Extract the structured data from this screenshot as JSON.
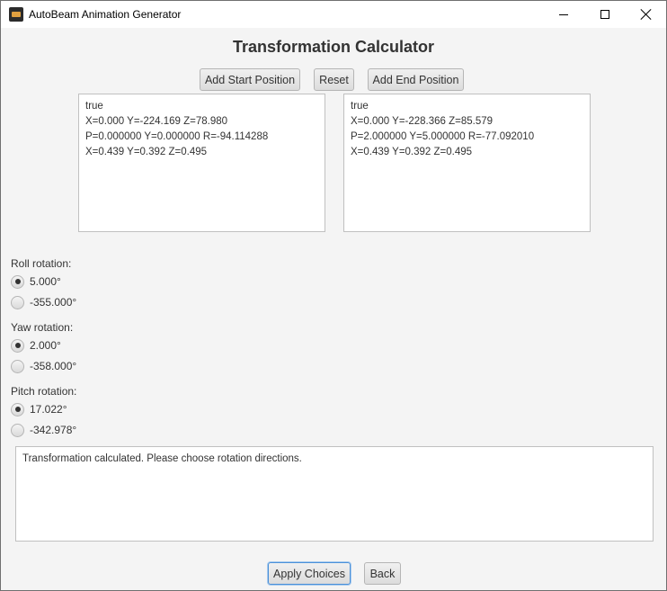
{
  "window": {
    "title": "AutoBeam Animation Generator",
    "minimize_symbol": "",
    "maximize_symbol": "",
    "close_symbol": ""
  },
  "main": {
    "heading": "Transformation Calculator",
    "buttons": {
      "add_start": "Add Start Position",
      "reset": "Reset",
      "add_end": "Add End Position"
    },
    "start_text": "true\nX=0.000 Y=-224.169 Z=78.980\nP=0.000000 Y=0.000000 R=-94.114288\nX=0.439 Y=0.392 Z=0.495",
    "end_text": "true\nX=0.000 Y=-228.366 Z=85.579\nP=2.000000 Y=5.000000 R=-77.092010\nX=0.439 Y=0.392 Z=0.495",
    "roll": {
      "label": "Roll rotation:",
      "options": [
        {
          "label": "5.000°",
          "selected": true
        },
        {
          "label": "-355.000°",
          "selected": false
        }
      ]
    },
    "yaw": {
      "label": "Yaw rotation:",
      "options": [
        {
          "label": "2.000°",
          "selected": true
        },
        {
          "label": "-358.000°",
          "selected": false
        }
      ]
    },
    "pitch": {
      "label": "Pitch rotation:",
      "options": [
        {
          "label": "17.022°",
          "selected": true
        },
        {
          "label": "-342.978°",
          "selected": false
        }
      ]
    },
    "status_text": "Transformation calculated. Please choose rotation directions.",
    "footer": {
      "apply": "Apply Choices",
      "back": "Back"
    }
  }
}
